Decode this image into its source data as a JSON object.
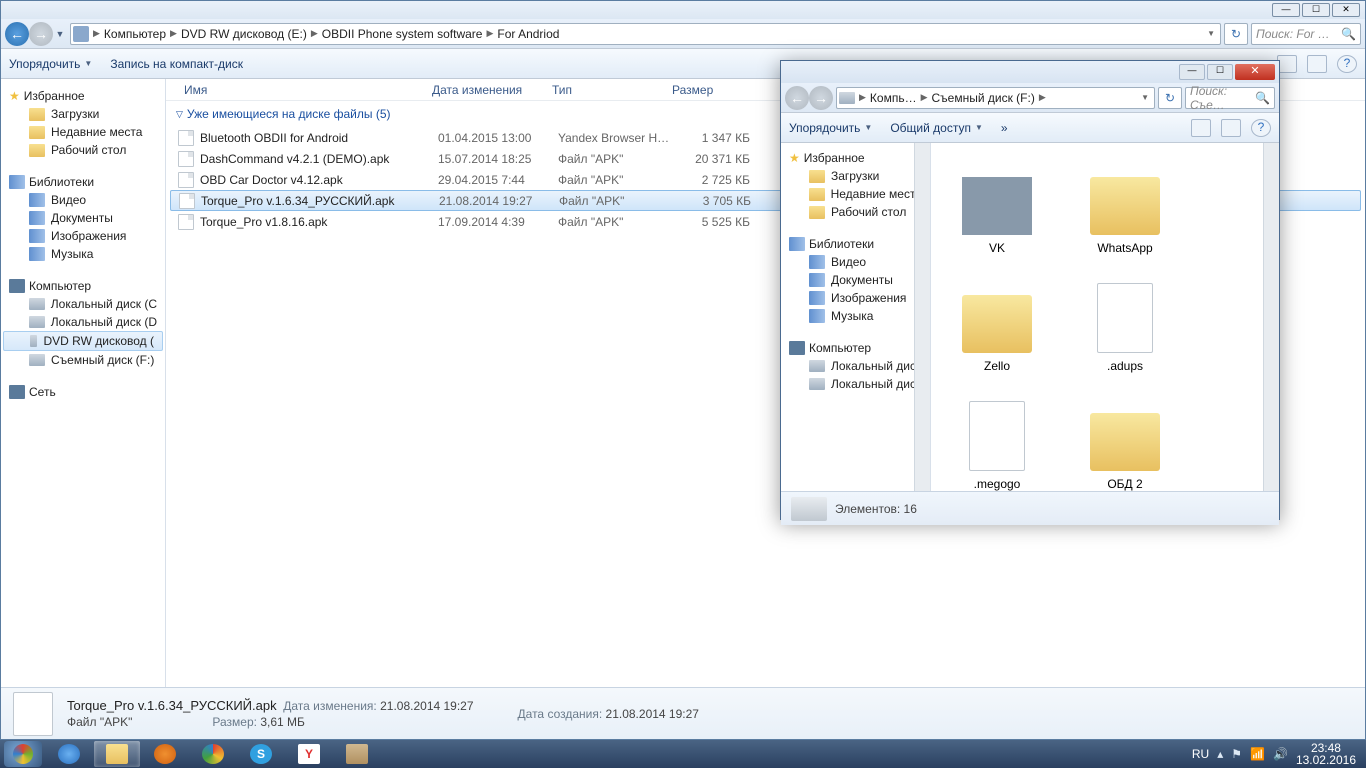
{
  "main": {
    "breadcrumb": [
      "Компьютер",
      "DVD RW дисковод (E:)",
      "OBDII Phone system software",
      "For Andriod"
    ],
    "search_placeholder": "Поиск: For …",
    "toolbar": {
      "organize": "Упорядочить",
      "burn": "Запись на компакт-диск"
    },
    "columns": {
      "name": "Имя",
      "date": "Дата изменения",
      "type": "Тип",
      "size": "Размер"
    },
    "group_header": "Уже имеющиеся на диске файлы (5)",
    "files": [
      {
        "name": "Bluetooth OBDII for Android",
        "date": "01.04.2015 13:00",
        "type": "Yandex Browser H…",
        "size": "1 347 КБ"
      },
      {
        "name": "DashCommand v4.2.1 (DEMO).apk",
        "date": "15.07.2014 18:25",
        "type": "Файл \"APK\"",
        "size": "20 371 КБ"
      },
      {
        "name": "OBD Car Doctor v4.12.apk",
        "date": "29.04.2015 7:44",
        "type": "Файл \"APK\"",
        "size": "2 725 КБ"
      },
      {
        "name": "Torque_Pro v.1.6.34_РУССКИЙ.apk",
        "date": "21.08.2014 19:27",
        "type": "Файл \"APK\"",
        "size": "3 705 КБ"
      },
      {
        "name": "Torque_Pro v1.8.16.apk",
        "date": "17.09.2014 4:39",
        "type": "Файл \"APK\"",
        "size": "5 525 КБ"
      }
    ],
    "nav": {
      "favorites_hdr": "Избранное",
      "favorites": [
        "Загрузки",
        "Недавние места",
        "Рабочий стол"
      ],
      "libraries_hdr": "Библиотеки",
      "libraries": [
        "Видео",
        "Документы",
        "Изображения",
        "Музыка"
      ],
      "computer_hdr": "Компьютер",
      "drives": [
        "Локальный диск (C",
        "Локальный диск (D",
        "DVD RW дисковод (",
        "Съемный диск (F:)"
      ],
      "network_hdr": "Сеть"
    },
    "details": {
      "title": "Torque_Pro v.1.6.34_РУССКИЙ.apk",
      "type": "Файл \"APK\"",
      "mod_label": "Дата изменения:",
      "mod_val": "21.08.2014 19:27",
      "crt_label": "Дата создания:",
      "crt_val": "21.08.2014 19:27",
      "size_label": "Размер:",
      "size_val": "3,61 МБ"
    }
  },
  "sec": {
    "breadcrumb": [
      "Компь…",
      "Съемный диск (F:)"
    ],
    "search_placeholder": "Поиск: Съе…",
    "toolbar": {
      "organize": "Упорядочить",
      "share": "Общий доступ"
    },
    "nav": {
      "favorites_hdr": "Избранное",
      "favorites": [
        "Загрузки",
        "Недавние места",
        "Рабочий стол"
      ],
      "libraries_hdr": "Библиотеки",
      "libraries": [
        "Видео",
        "Документы",
        "Изображения",
        "Музыка"
      ],
      "computer_hdr": "Компьютер",
      "drives": [
        "Локальный диск",
        "Локальный диск"
      ]
    },
    "items": [
      {
        "name": "VK",
        "kind": "thumb"
      },
      {
        "name": "WhatsApp",
        "kind": "folder"
      },
      {
        "name": "Zello",
        "kind": "folder"
      },
      {
        "name": ".adups",
        "kind": "file"
      },
      {
        "name": ".megogo",
        "kind": "file"
      },
      {
        "name": "ОБД 2",
        "kind": "folder"
      }
    ],
    "status": "Элементов: 16"
  },
  "taskbar": {
    "lang": "RU",
    "time": "23:48",
    "date": "13.02.2016"
  }
}
